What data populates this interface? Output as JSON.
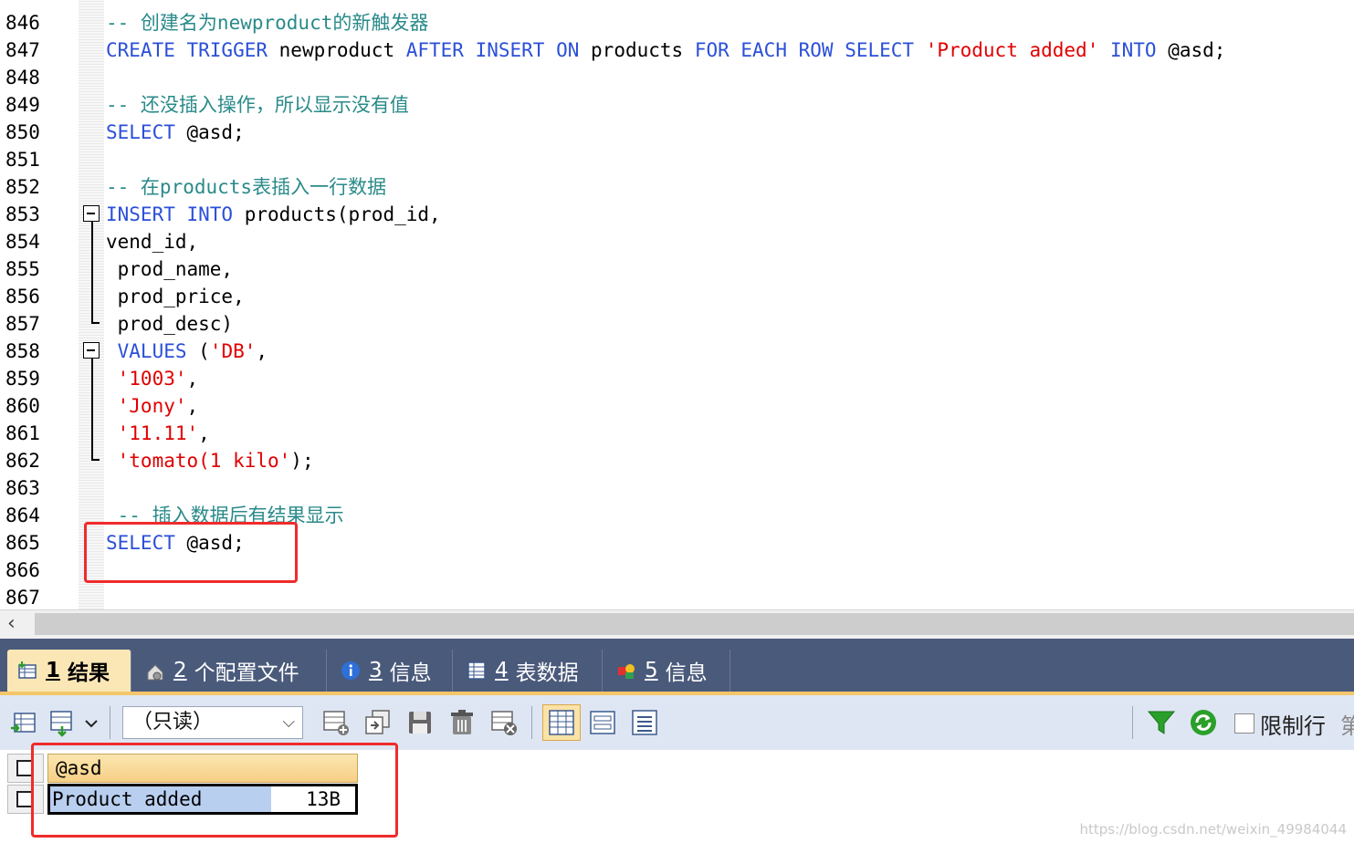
{
  "editor": {
    "line_numbers": [
      "846",
      "847",
      "848",
      "849",
      "850",
      "851",
      "852",
      "853",
      "854",
      "855",
      "856",
      "857",
      "858",
      "859",
      "860",
      "861",
      "862",
      "863",
      "864",
      "865",
      "866",
      "867"
    ],
    "lines": {
      "l846_comment": "-- 创建名为newproduct的新触发器",
      "l847_create": "CREATE TRIGGER",
      "l847_name": " newproduct ",
      "l847_after": "AFTER INSERT ON",
      "l847_table": " products ",
      "l847_for": "FOR EACH ROW SELECT",
      "l847_str": " 'Product added' ",
      "l847_into": "INTO",
      "l847_var": " @asd;",
      "l849_comment": "-- 还没插入操作，所以显示没有值",
      "l850_select": "SELECT",
      "l850_var": " @asd;",
      "l852_comment": "-- 在products表插入一行数据",
      "l853_kw": "INSERT INTO",
      "l853_rest": " products(prod_id,",
      "l854": "vend_id,",
      "l855": " prod_name,",
      "l856": " prod_price,",
      "l857": " prod_desc)",
      "l858_kw": " VALUES",
      "l858_pre": " (",
      "l858_str": "'DB'",
      "l858_post": ",",
      "l859_str": " '1003'",
      "l859_post": ",",
      "l860_str": " 'Jony'",
      "l860_post": ",",
      "l861_str": " '11.11'",
      "l861_post": ",",
      "l862_str": " 'tomato(1 kilo'",
      "l862_post": ");",
      "l864_comment": " -- 插入数据后有结果显示",
      "l865_select": "SELECT",
      "l865_var": " @asd;"
    }
  },
  "tabs": [
    {
      "num": "1",
      "label": "结果"
    },
    {
      "num": "2",
      "label": "个配置文件"
    },
    {
      "num": "3",
      "label": "信息"
    },
    {
      "num": "4",
      "label": "表数据"
    },
    {
      "num": "5",
      "label": "信息"
    }
  ],
  "toolbar": {
    "readonly_select": "（只读）",
    "limit_rows_label": "限制行",
    "limit_more": "第"
  },
  "results": {
    "column_header": "@asd",
    "cell_value": "Product added",
    "cell_size": "13B"
  },
  "watermark": "https://blog.csdn.net/weixin_49984044",
  "colors": {
    "keyword": "#2b4fd8",
    "string": "#e00000",
    "comment": "#2a8a8a",
    "highlight_box": "#ef2b2b",
    "tab_bar": "#4a5a7b",
    "active_tab": "#fbe7b6",
    "header_cell": "#f6cf86",
    "selected_cell": "#b9cff0"
  }
}
